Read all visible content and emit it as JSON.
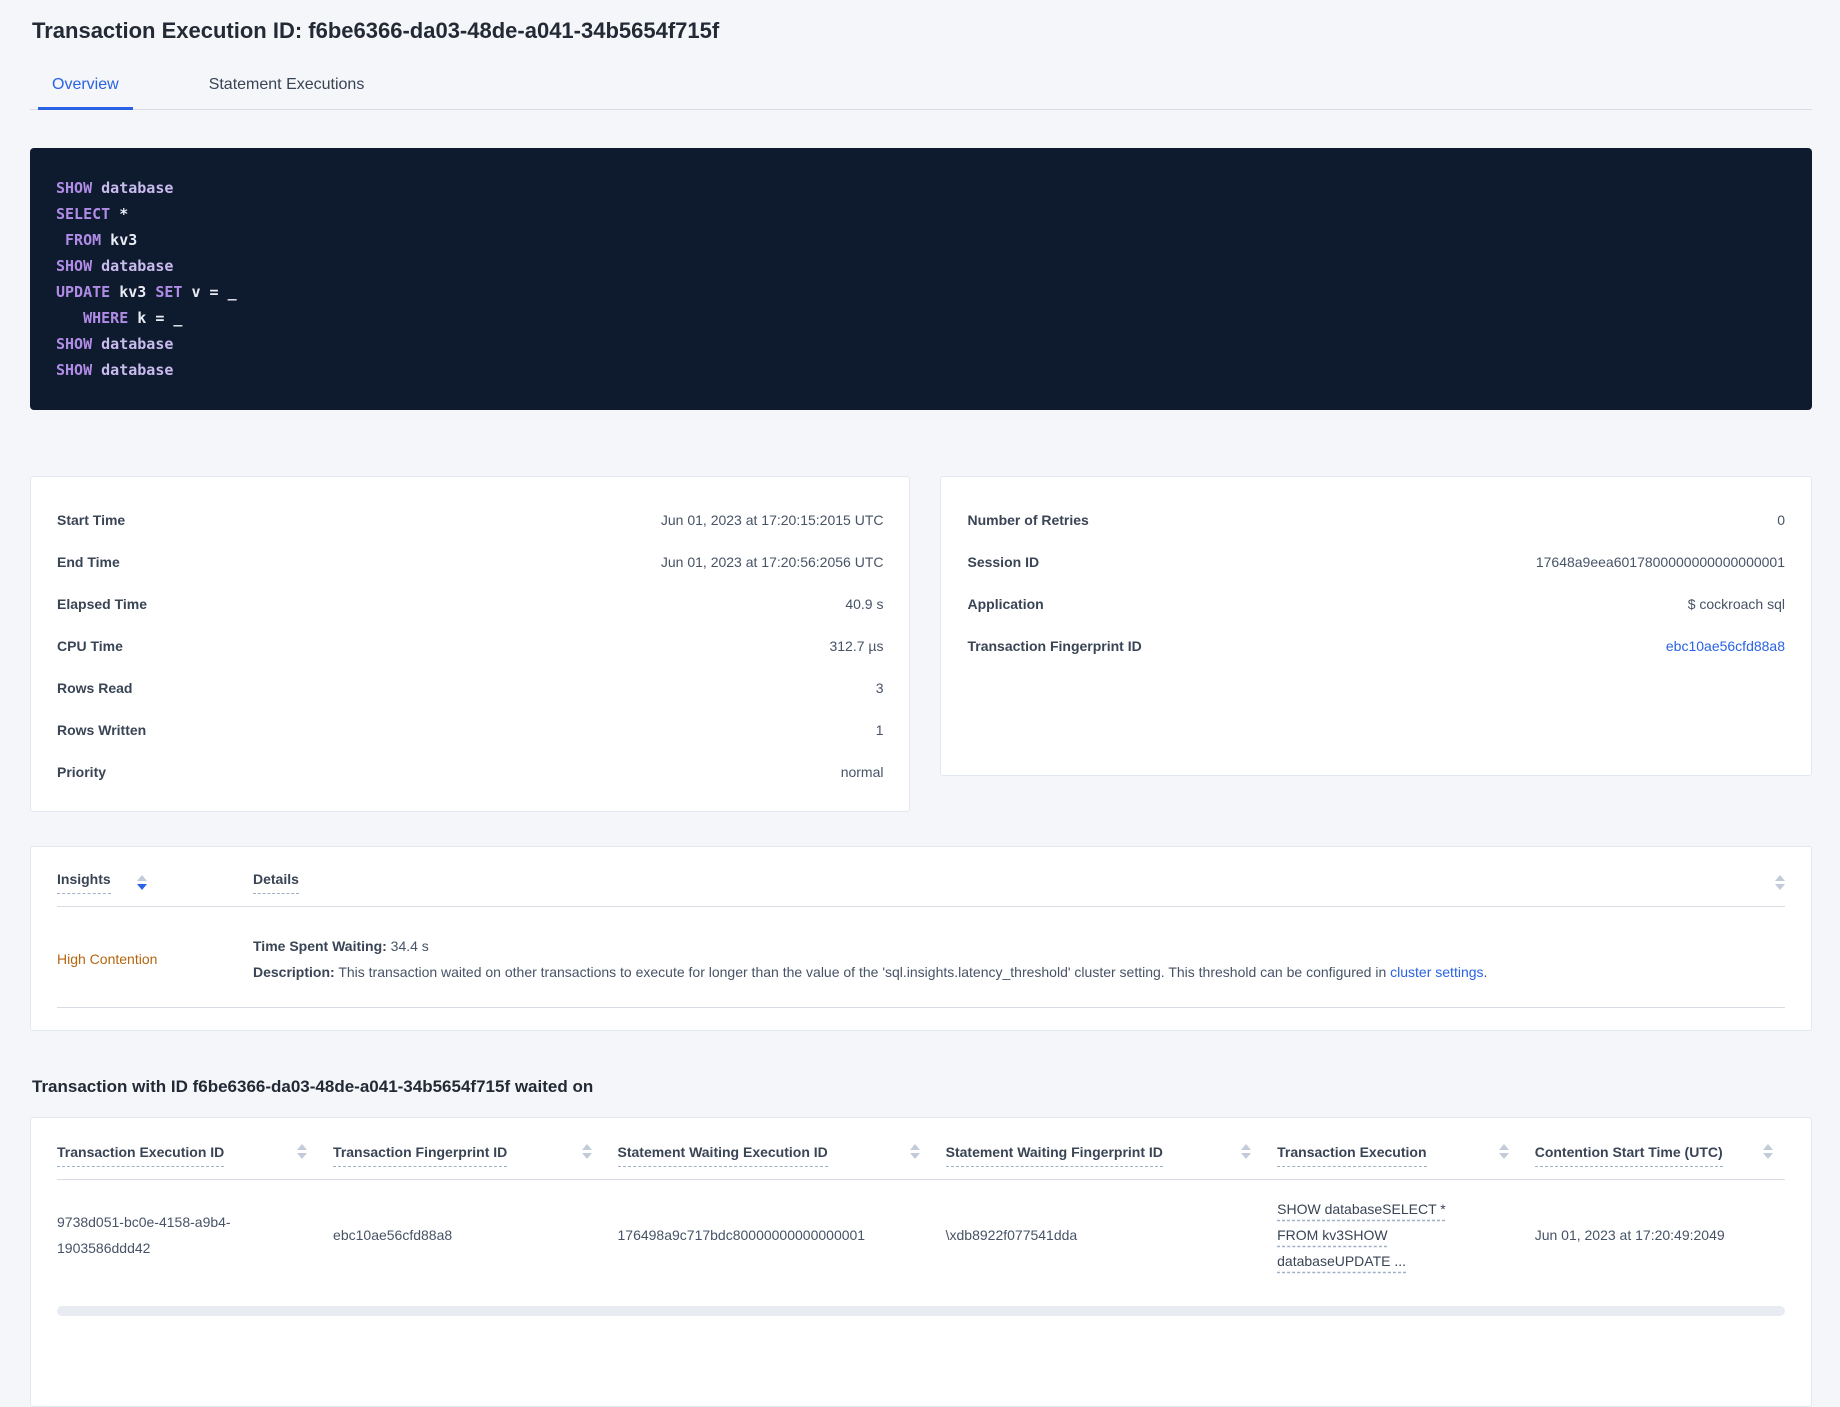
{
  "page_title": "Transaction Execution ID: f6be6366-da03-48de-a041-34b5654f715f",
  "tabs": {
    "overview": "Overview",
    "statement_executions": "Statement Executions"
  },
  "sql_lines": [
    {
      "tokens": [
        {
          "text": "SHOW",
          "type": "kw"
        },
        {
          "text": " database",
          "type": "ident"
        }
      ]
    },
    {
      "tokens": [
        {
          "text": "SELECT",
          "type": "kw"
        },
        {
          "text": " *",
          "type": "plain"
        }
      ]
    },
    {
      "tokens": [
        {
          "text": " FROM",
          "type": "kw"
        },
        {
          "text": " kv3",
          "type": "plain"
        }
      ]
    },
    {
      "tokens": [
        {
          "text": "SHOW",
          "type": "kw"
        },
        {
          "text": " database",
          "type": "ident"
        }
      ]
    },
    {
      "tokens": [
        {
          "text": "UPDATE",
          "type": "kw"
        },
        {
          "text": " kv3 ",
          "type": "plain"
        },
        {
          "text": "SET",
          "type": "kw"
        },
        {
          "text": " v = _",
          "type": "plain"
        }
      ]
    },
    {
      "tokens": [
        {
          "text": "   WHERE",
          "type": "kw"
        },
        {
          "text": " k = _",
          "type": "plain"
        }
      ]
    },
    {
      "tokens": [
        {
          "text": "SHOW",
          "type": "kw"
        },
        {
          "text": " database",
          "type": "ident"
        }
      ]
    },
    {
      "tokens": [
        {
          "text": "SHOW",
          "type": "kw"
        },
        {
          "text": " database",
          "type": "ident"
        }
      ]
    }
  ],
  "summary_left": {
    "rows": [
      {
        "label": "Start Time",
        "value": "Jun 01, 2023 at 17:20:15:2015 UTC"
      },
      {
        "label": "End Time",
        "value": "Jun 01, 2023 at 17:20:56:2056 UTC"
      },
      {
        "label": "Elapsed Time",
        "value": "40.9 s"
      },
      {
        "label": "CPU Time",
        "value": "312.7 µs"
      },
      {
        "label": "Rows Read",
        "value": "3"
      },
      {
        "label": "Rows Written",
        "value": "1"
      },
      {
        "label": "Priority",
        "value": "normal"
      }
    ]
  },
  "summary_right": {
    "rows": [
      {
        "label": "Number of Retries",
        "value": "0"
      },
      {
        "label": "Session ID",
        "value": "17648a9eea6017800000000000000001"
      },
      {
        "label": "Application",
        "value": "$ cockroach sql"
      },
      {
        "label": "Transaction Fingerprint ID",
        "value": "ebc10ae56cfd88a8"
      }
    ]
  },
  "insights": {
    "header_insights": "Insights",
    "header_details": "Details",
    "row": {
      "insight_label": "High Contention",
      "waiting_label": "Time Spent Waiting:",
      "waiting_value": " 34.4 s",
      "description_label": "Description:",
      "description_text": " This transaction waited on other transactions to execute for longer than the value of the 'sql.insights.latency_threshold' cluster setting. This threshold can be configured in ",
      "description_link": "cluster settings",
      "description_end": "."
    }
  },
  "waited_section": {
    "heading": "Transaction with ID f6be6366-da03-48de-a041-34b5654f715f waited on",
    "columns": [
      "Transaction Execution ID",
      "Transaction Fingerprint ID",
      "Statement Waiting Execution ID",
      "Statement Waiting Fingerprint ID",
      "Transaction Execution",
      "Contention Start Time (UTC)"
    ],
    "row": {
      "transaction_execution_id": "9738d051-bc0e-4158-a9b4-1903586ddd42",
      "transaction_fingerprint_id": "ebc10ae56cfd88a8",
      "statement_waiting_execution_id": "176498a9c717bdc80000000000000001",
      "statement_waiting_fingerprint_id": "\\xdb8922f077541dda",
      "transaction_execution": "SHOW databaseSELECT * FROM kv3SHOW databaseUPDATE ...",
      "contention_start_time": "Jun 01, 2023 at 17:20:49:2049"
    }
  },
  "colors": {
    "accent_blue": "#2962e4",
    "high_contention_orange": "#b5650e",
    "sql_box_background": "#0e1b2f",
    "sql_keyword_purple": "#b18ce6",
    "sql_identifier_lavender": "#c9bbee"
  }
}
